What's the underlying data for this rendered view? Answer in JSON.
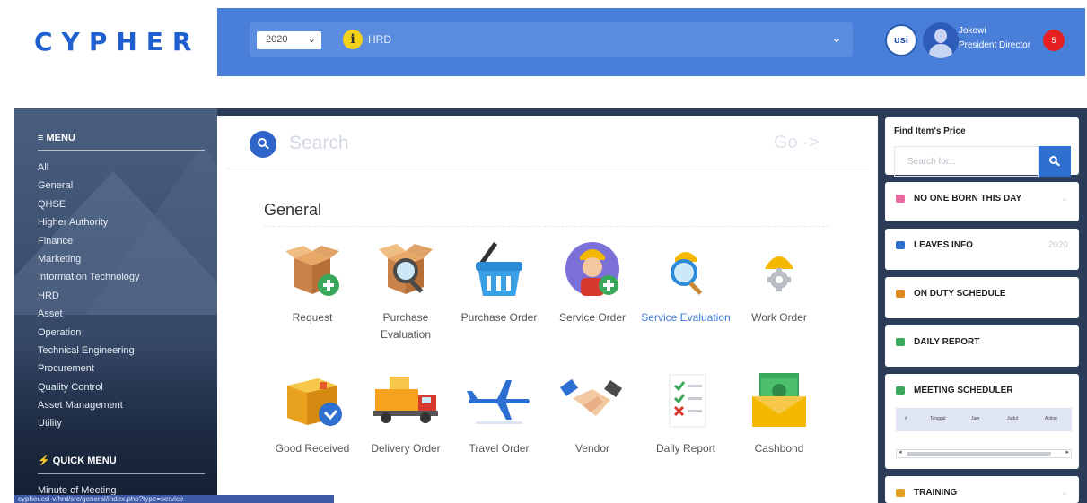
{
  "header": {
    "logo_text": "CYPHER",
    "year_select": "2020",
    "department": "HRD",
    "university_logo": "usi",
    "user": {
      "name": "Jokowi",
      "role": "President Director"
    },
    "notification_count": "5"
  },
  "sidebar": {
    "menu_title": "≡ MENU",
    "menu_items": [
      "All",
      "General",
      "QHSE",
      "Higher Authority",
      "Finance",
      "Marketing",
      "Information Technology",
      "HRD",
      "Asset",
      "Operation",
      "Technical Engineering",
      "Procurement",
      "Quality Control",
      "Asset Management",
      "Utility"
    ],
    "quick_menu_title": "⚡ QUICK MENU",
    "quick_menu_items": [
      "Minute of Meeting"
    ],
    "status_url": "cypher.csi-v/hrd/src/general/index.php?type=service"
  },
  "search": {
    "placeholder": "Search",
    "go_label": "Go ->"
  },
  "section": {
    "title": "General",
    "tiles": [
      {
        "label": "Request",
        "icon": "box-plus-icon"
      },
      {
        "label": "Purchase Evaluation",
        "icon": "box-magnifier-icon"
      },
      {
        "label": "Purchase Order",
        "icon": "shopping-basket-icon"
      },
      {
        "label": "Service Order",
        "icon": "worker-plus-icon"
      },
      {
        "label": "Service Evaluation",
        "icon": "worker-magnifier-icon"
      },
      {
        "label": "Work Order",
        "icon": "helmet-gear-icon"
      },
      {
        "label": "Good Received",
        "icon": "box-check-icon"
      },
      {
        "label": "Delivery Order",
        "icon": "truck-icon"
      },
      {
        "label": "Travel Order",
        "icon": "airplane-icon"
      },
      {
        "label": "Vendor",
        "icon": "handshake-icon"
      },
      {
        "label": "Daily Report",
        "icon": "checklist-icon"
      },
      {
        "label": "Cashbond",
        "icon": "money-envelope-icon"
      }
    ]
  },
  "right_panel": {
    "price": {
      "title": "Find Item's Price",
      "placeholder": "Search for..."
    },
    "widgets": [
      {
        "label": "NO ONE BORN THIS DAY",
        "color": "#e86aa0",
        "right": "⌄"
      },
      {
        "label": "LEAVES INFO",
        "color": "#2f6fd0",
        "right": "2020"
      },
      {
        "label": "ON DUTY SCHEDULE",
        "color": "#e08a1e",
        "right": ""
      },
      {
        "label": "DAILY REPORT",
        "color": "#3aa85a",
        "right": ""
      },
      {
        "label": "MEETING SCHEDULER",
        "color": "#3aa85a",
        "right": ""
      },
      {
        "label": "TRAINING",
        "color": "#e0a11e",
        "right": "⌄"
      }
    ],
    "scheduler_columns": [
      "#",
      "Tanggal",
      "Jam",
      "Judul",
      "Action"
    ]
  },
  "colors": {
    "brand_blue": "#1f5fcf",
    "topbar": "#4a7fd9",
    "notification": "#e52020",
    "link_active": "#3d7ad6"
  }
}
